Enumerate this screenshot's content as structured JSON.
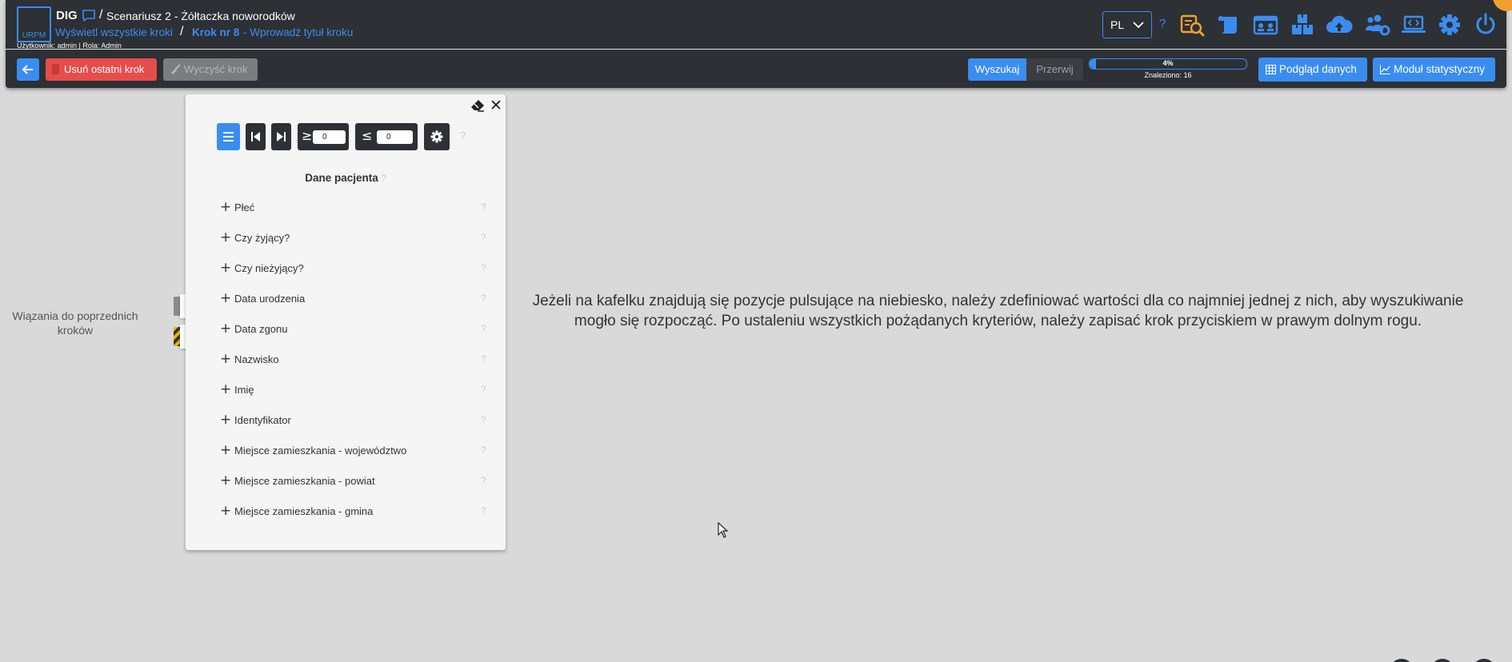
{
  "header": {
    "logo_text": "URPM",
    "app_name": "DIG",
    "breadcrumb_separator": "/",
    "scenario_title": "Scenariusz 2 - Żółtaczka noworodków",
    "all_steps_link": "Wyświetl wszystkie kroki",
    "step_number": "Krok nr 8",
    "step_title_link": "- Wprowadź tytuł kroku",
    "user_info": "Użytkownik: admin | Rola: Admin",
    "language": "PL",
    "help": "?",
    "icons": [
      "search-report-icon",
      "scroll-icon",
      "id-cards-icon",
      "boxes-icon",
      "cloud-upload-icon",
      "users-cog-icon",
      "laptop-code-icon",
      "gear-icon",
      "power-icon"
    ]
  },
  "toolbar": {
    "delete_last_step": "Usuń ostatni krok",
    "clear_step": "Wyczyść krok",
    "search": "Wyszukaj",
    "stop": "Przerwij",
    "progress_label": "4%",
    "progress_value": 0.04,
    "found": "Znaleziono: 16",
    "data_preview": "Podgląd danych",
    "stats_module": "Moduł statystyczny"
  },
  "bindings": {
    "label": "Wiązania do poprzednich kroków"
  },
  "panel": {
    "gte_symbol": "≥",
    "lte_symbol": "≤",
    "gte_value": "0",
    "lte_value": "0",
    "help": "?",
    "title": "Dane pacjenta",
    "fields": [
      {
        "label": "Płeć",
        "help": "?"
      },
      {
        "label": "Czy żyjący?",
        "help": "?"
      },
      {
        "label": "Czy nieżyjący?",
        "help": "?"
      },
      {
        "label": "Data urodzenia",
        "help": "?"
      },
      {
        "label": "Data zgonu",
        "help": "?"
      },
      {
        "label": "Nazwisko",
        "help": "?"
      },
      {
        "label": "Imię",
        "help": "?"
      },
      {
        "label": "Identyfikator",
        "help": "?"
      },
      {
        "label": "Miejsce zamieszkania - województwo",
        "help": "?"
      },
      {
        "label": "Miejsce zamieszkania - powiat",
        "help": "?"
      },
      {
        "label": "Miejsce zamieszkania - gmina",
        "help": "?"
      }
    ]
  },
  "info_text": "Jeżeli na kafelku znajdują się pozycje pulsujące na niebiesko, należy zdefiniować wartości dla co najmniej jednej z nich, aby wyszukiwanie mogło się rozpocząć. Po ustaleniu wszystkich pożądanych kryteriów, należy zapisać krok przyciskiem w prawym dolnym rogu.",
  "colors": {
    "accent": "#3a8df0",
    "header_bg": "#2d3035",
    "danger": "#e74c4c",
    "icon_orange": "#f0a030",
    "page_bg": "#d9d9d9"
  }
}
